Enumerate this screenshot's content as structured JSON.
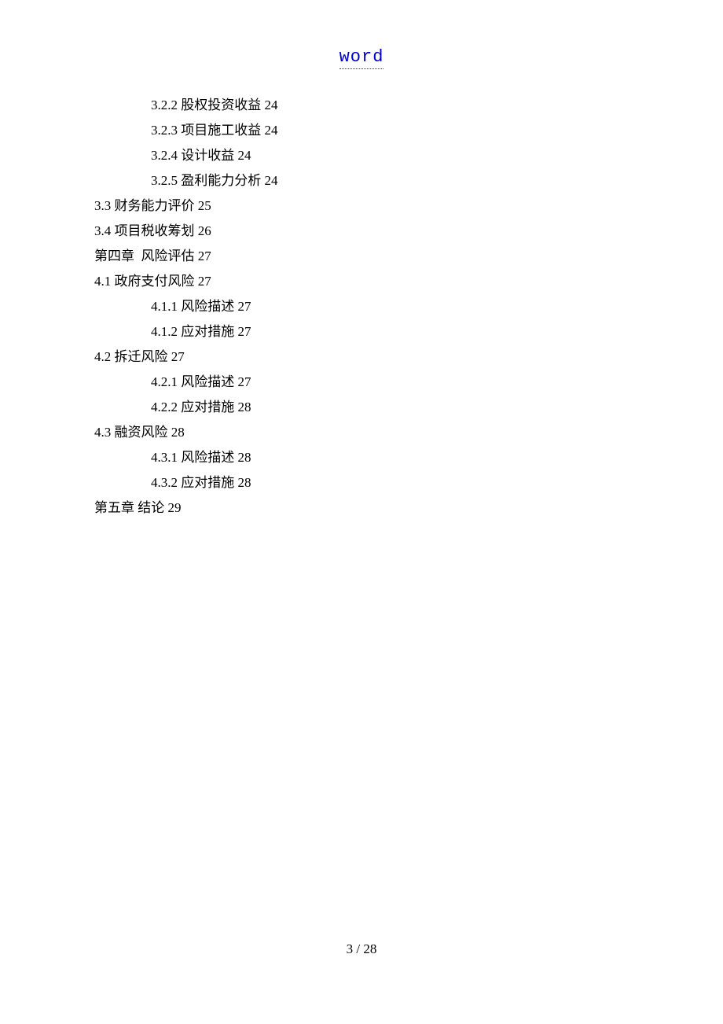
{
  "header": {
    "link_text": "word"
  },
  "toc": [
    {
      "level": 1,
      "num": "3.2.2",
      "title": "股权投资收益",
      "page": "24"
    },
    {
      "level": 1,
      "num": "3.2.3",
      "title": "项目施工收益",
      "page": "24"
    },
    {
      "level": 1,
      "num": "3.2.4",
      "title": "设计收益",
      "page": "24"
    },
    {
      "level": 1,
      "num": "3.2.5",
      "title": "盈利能力分析",
      "page": "24"
    },
    {
      "level": 0,
      "num": "3.3",
      "title": "财务能力评价",
      "page": "25"
    },
    {
      "level": 0,
      "num": "3.4",
      "title": "项目税收筹划",
      "page": "26"
    },
    {
      "level": 0,
      "num": "第四章",
      "title": " 风险评估",
      "page": "27",
      "chapter": true
    },
    {
      "level": 0,
      "num": "4.1",
      "title": "政府支付风险",
      "page": "27"
    },
    {
      "level": 1,
      "num": "4.1.1",
      "title": "风险描述",
      "page": "27"
    },
    {
      "level": 1,
      "num": "4.1.2",
      "title": "应对措施",
      "page": "27"
    },
    {
      "level": 0,
      "num": "4.2",
      "title": "拆迁风险",
      "page": "27"
    },
    {
      "level": 1,
      "num": "4.2.1",
      "title": "风险描述",
      "page": "27"
    },
    {
      "level": 1,
      "num": "4.2.2",
      "title": "应对措施",
      "page": "28"
    },
    {
      "level": 0,
      "num": "4.3",
      "title": "融资风险",
      "page": "28"
    },
    {
      "level": 1,
      "num": "4.3.1",
      "title": "风险描述",
      "page": "28"
    },
    {
      "level": 1,
      "num": "4.3.2",
      "title": "应对措施",
      "page": "28"
    },
    {
      "level": 0,
      "num": "第五章",
      "title": "结论",
      "page": "29",
      "chapter": true
    }
  ],
  "footer": {
    "page_indicator": "3 / 28"
  }
}
